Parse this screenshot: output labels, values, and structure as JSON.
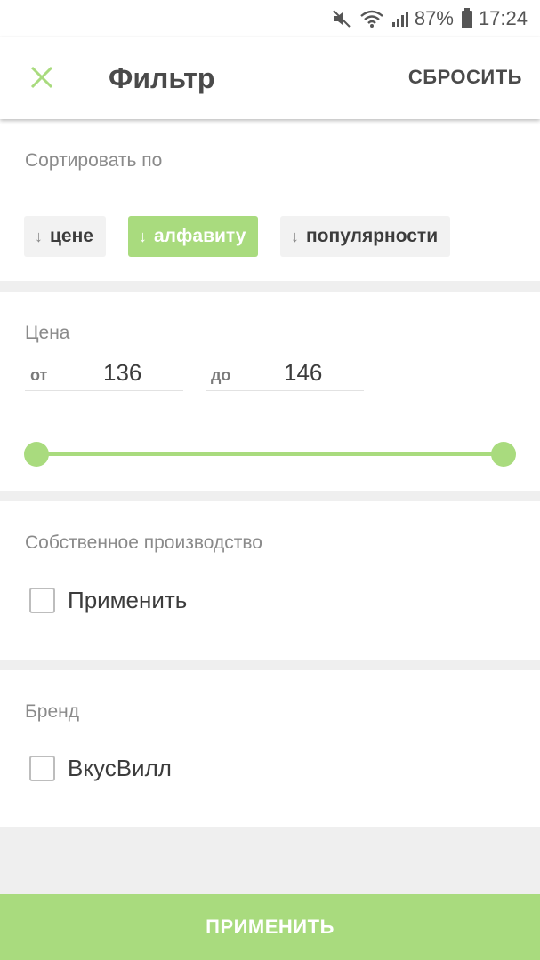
{
  "status_bar": {
    "battery": "87%",
    "time": "17:24",
    "icons": [
      "mute-icon",
      "wifi-icon",
      "signal-icon",
      "battery-icon"
    ]
  },
  "header": {
    "title": "Фильтр",
    "reset_label": "СБРОСИТЬ",
    "close_icon": "close-icon"
  },
  "sort": {
    "title": "Сортировать по",
    "options": [
      {
        "label": "цене",
        "active": false
      },
      {
        "label": "алфавиту",
        "active": true
      },
      {
        "label": "популярности",
        "active": false
      }
    ]
  },
  "price": {
    "title": "Цена",
    "from_prefix": "от",
    "from_value": "136",
    "to_prefix": "до",
    "to_value": "146",
    "range_fraction": [
      0,
      1
    ]
  },
  "own_production": {
    "title": "Собственное производство",
    "checkbox_label": "Применить",
    "checked": false
  },
  "brand": {
    "title": "Бренд",
    "checkbox_label": "ВкусВилл",
    "checked": false
  },
  "apply_button": {
    "label": "ПРИМЕНИТЬ"
  },
  "colors": {
    "accent": "#a9db7e",
    "text": "#3c3c3c",
    "muted": "#8a8a8a"
  }
}
